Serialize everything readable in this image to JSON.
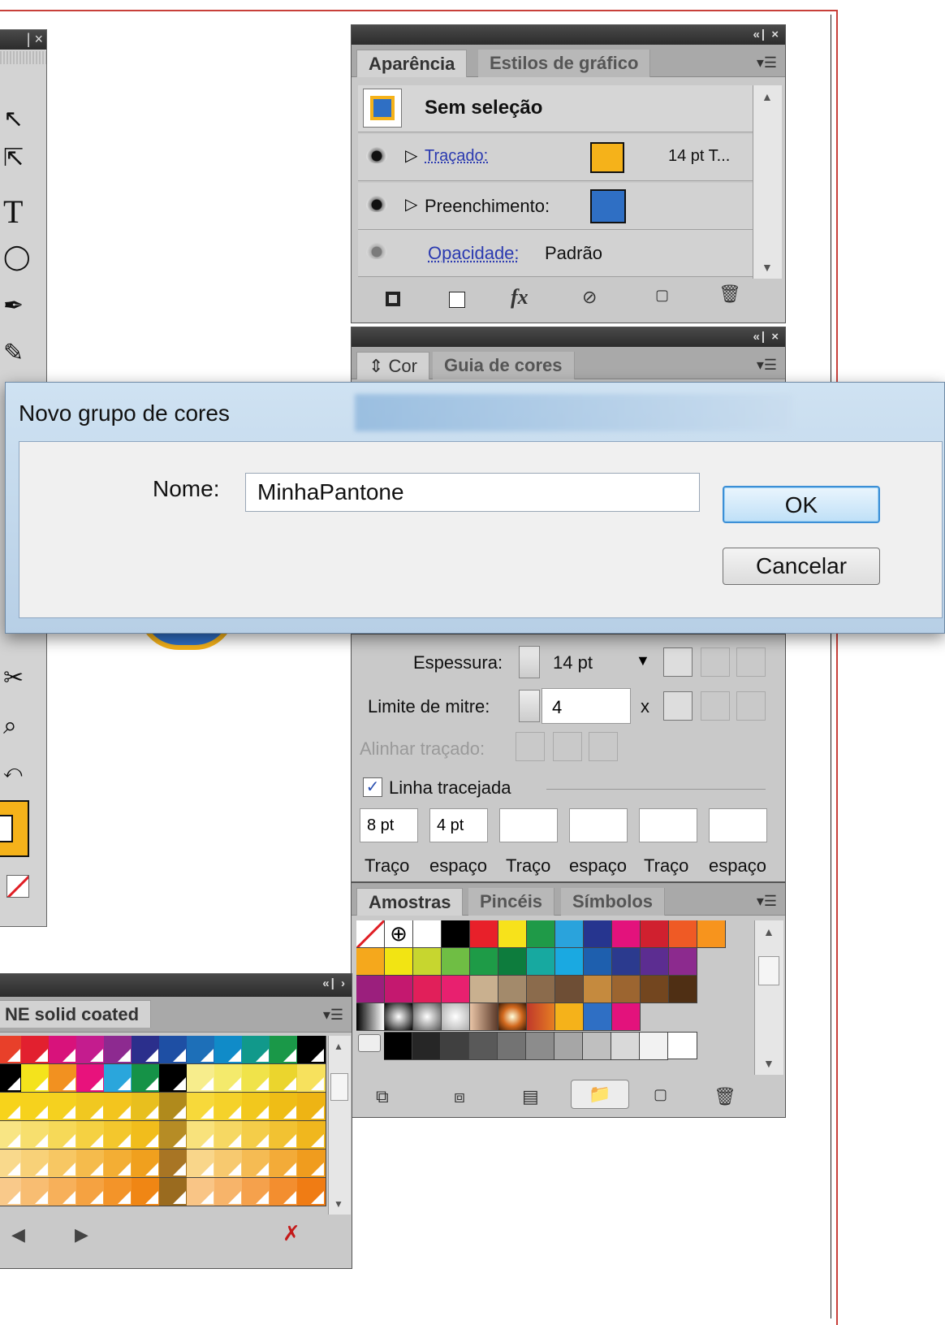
{
  "appearance_panel": {
    "tabs": [
      "Aparência",
      "Estilos de gráfico"
    ],
    "header_label": "Sem seleção",
    "rows": [
      {
        "label": "Traçado:",
        "value": "14 pt T...",
        "swatch": "#f5b21a"
      },
      {
        "label": "Preenchimento:",
        "value": "",
        "swatch": "#2f6fc4"
      },
      {
        "label": "Opacidade:",
        "value": "Padrão"
      }
    ],
    "footer_icons": [
      "add-stroke-icon",
      "add-fill-icon",
      "fx-icon",
      "clear-icon",
      "duplicate-icon",
      "trash-icon"
    ],
    "fx_label": "fx"
  },
  "color_panel": {
    "tabs": [
      "Cor",
      "Guia de cores"
    ]
  },
  "dialog": {
    "title": "Novo grupo de cores",
    "name_label": "Nome:",
    "name_value": "MinhaPantone",
    "ok_label": "OK",
    "cancel_label": "Cancelar"
  },
  "stroke_panel": {
    "weight_label": "Espessura:",
    "weight_value": "14 pt",
    "miter_label": "Limite de mitre:",
    "miter_value": "4",
    "miter_unit": "x",
    "align_label": "Alinhar traçado:",
    "dashed_label": "Linha tracejada",
    "dashed_checked": true,
    "dash_values": [
      "8 pt",
      "4 pt",
      "",
      "",
      "",
      ""
    ],
    "dash_labels": [
      "Traço",
      "espaço",
      "Traço",
      "espaço",
      "Traço",
      "espaço"
    ]
  },
  "swatches_panel": {
    "tabs": [
      "Amostras",
      "Pincéis",
      "Símbolos"
    ],
    "row1": [
      "#ffffff",
      "#000000",
      "#e8202a",
      "#f7e21b",
      "#1f9a48",
      "#2aa3dc",
      "#26358f",
      "#e3127c",
      "#d0202f",
      "#ef5a25",
      "#f7941d"
    ],
    "row2": [
      "#f5a81c",
      "#f2e413",
      "#c7d62f",
      "#6fbe44",
      "#1e9b47",
      "#0d7c3d",
      "#17a9a0",
      "#1aa9e1",
      "#1e5fae",
      "#2b3a8e",
      "#5c2d91",
      "#8c2a8e"
    ],
    "row3": [
      "#9b1f7d",
      "#c4186f",
      "#e11f5a",
      "#e8206f",
      "#c9b08f",
      "#a38a6b",
      "#8b6b4c",
      "#6e4e35",
      "#c58a3e",
      "#9c6530",
      "#73461f",
      "#4f2f14"
    ],
    "gradient_swatches": [
      "#f5b21a",
      "#2f6fc4",
      "#e3127c"
    ],
    "gray_steps": [
      "#000000",
      "#262626",
      "#404040",
      "#595959",
      "#737373",
      "#8c8c8c",
      "#a6a6a6",
      "#bfbfbf",
      "#d9d9d9",
      "#f2f2f2"
    ],
    "footer_icons": [
      "library-icon",
      "show-kinds-icon",
      "options-icon",
      "new-group-icon",
      "new-swatch-icon",
      "trash-icon"
    ]
  },
  "pantone_panel": {
    "tab_label": "NE solid coated",
    "colors": [
      [
        "#e8402a",
        "#e2202f",
        "#d8127b",
        "#c41c8e",
        "#8d2a90",
        "#2b2f8c",
        "#1e4fa4",
        "#1d6fb8",
        "#108bc8",
        "#11998b",
        "#1a9848",
        "#000000"
      ],
      [
        "#000000",
        "#f4e31c",
        "#f29120",
        "#e8127c",
        "#2aa6dc",
        "#159247",
        "#000000",
        "#f7ed8c",
        "#f4ea6c",
        "#f0e34a",
        "#ebd52d",
        "#f7e15d"
      ],
      [
        "#f7d31b",
        "#f6d21d",
        "#f5d11f",
        "#f1c820",
        "#f3c51e",
        "#e8bf1e",
        "#b08a1c",
        "#f7d93a",
        "#f5d22a",
        "#f2c81d",
        "#efbd16",
        "#eeb414"
      ],
      [
        "#f8e584",
        "#f7df6e",
        "#f6d958",
        "#f5d142",
        "#f3c72d",
        "#f1bd1c",
        "#b68c25",
        "#f8e27c",
        "#f6d863",
        "#f4cd49",
        "#f2c232",
        "#f0b71e"
      ],
      [
        "#f9d98c",
        "#f8d178",
        "#f7c763",
        "#f5bb4c",
        "#f3ae34",
        "#f0a01e",
        "#a87524",
        "#f9d68a",
        "#f7c96f",
        "#f5bb53",
        "#f3ab38",
        "#f09c1e"
      ],
      [
        "#f9c98a",
        "#f8bd72",
        "#f7b05a",
        "#f5a241",
        "#f39429",
        "#f08614",
        "#9a6b1f",
        "#f9c586",
        "#f7b46a",
        "#f5a14c",
        "#f38e2f",
        "#f07c14"
      ]
    ]
  },
  "toolbox": {
    "tools": [
      "direct-selection-icon",
      "group-selection-icon",
      "type-icon",
      "ellipse-icon",
      "pen-icon",
      "pencil-icon",
      "measure-icon",
      "zoom-icon",
      "swap-icon",
      "fill-stroke-icon",
      "none-icon"
    ]
  }
}
